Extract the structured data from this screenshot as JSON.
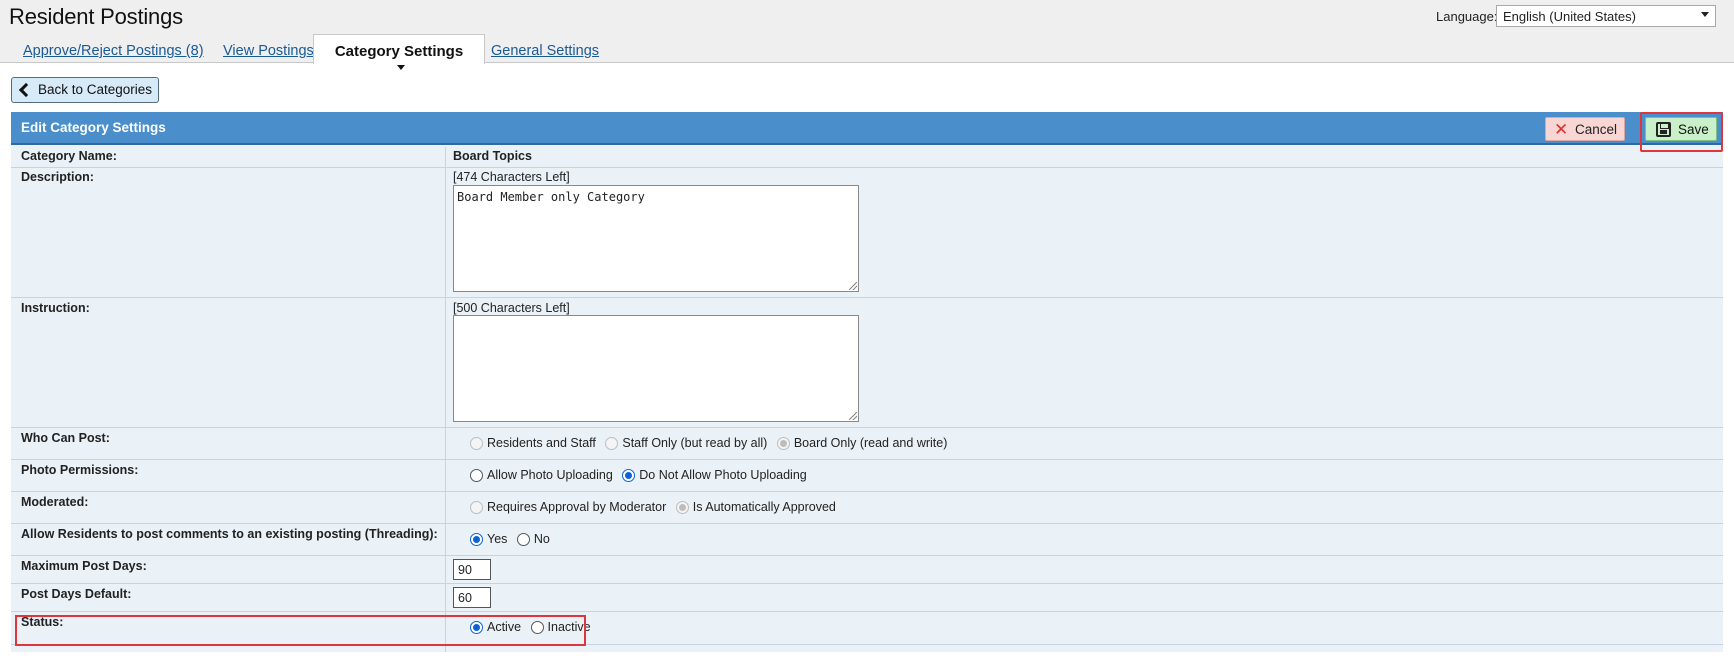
{
  "header": {
    "title": "Resident Postings",
    "language_label": "Language:",
    "language_value": "English (United States)",
    "tabs": [
      {
        "label": "Approve/Reject Postings (8)"
      },
      {
        "label": "View Postings"
      },
      {
        "label": "Category Settings"
      },
      {
        "label": "General Settings"
      }
    ]
  },
  "back_button": {
    "label": "Back to Categories"
  },
  "panel": {
    "title": "Edit Category Settings",
    "cancel_label": "Cancel",
    "save_label": "Save"
  },
  "form": {
    "category_name": {
      "label": "Category Name:",
      "value": "Board Topics"
    },
    "description": {
      "label": "Description:",
      "counter": "[474 Characters Left]",
      "value": "Board Member only Category"
    },
    "instruction": {
      "label": "Instruction:",
      "counter": "[500 Characters Left]",
      "value": ""
    },
    "who_can_post": {
      "label": "Who Can Post:",
      "options": [
        "Residents and Staff",
        "Staff Only (but read by all)",
        "Board Only (read and write)"
      ],
      "selected": "Board Only (read and write)"
    },
    "photo_permissions": {
      "label": "Photo Permissions:",
      "options": [
        "Allow Photo Uploading",
        "Do Not Allow Photo Uploading"
      ],
      "selected": "Do Not Allow Photo Uploading"
    },
    "moderated": {
      "label": "Moderated:",
      "options": [
        "Requires Approval by Moderator",
        "Is Automatically Approved"
      ],
      "selected": "Is Automatically Approved"
    },
    "threading": {
      "label": "Allow Residents to post comments to an existing posting (Threading):",
      "options": [
        "Yes",
        "No"
      ],
      "selected": "Yes"
    },
    "max_post_days": {
      "label": "Maximum Post Days:",
      "value": "90"
    },
    "post_days_default": {
      "label": "Post Days Default:",
      "value": "60"
    },
    "status": {
      "label": "Status:",
      "options": [
        "Active",
        "Inactive"
      ],
      "selected": "Active"
    }
  },
  "colors": {
    "panel_header": "#4a8fcb",
    "panel_body": "#eaf1f7",
    "highlight": "#e0363b",
    "save_bg": "#c9f0c9",
    "cancel_bg": "#f7d6d4",
    "link": "#1a5a96"
  },
  "icons": {
    "back": "chevron-left-icon",
    "cancel": "x-icon",
    "save": "floppy-disk-icon"
  }
}
